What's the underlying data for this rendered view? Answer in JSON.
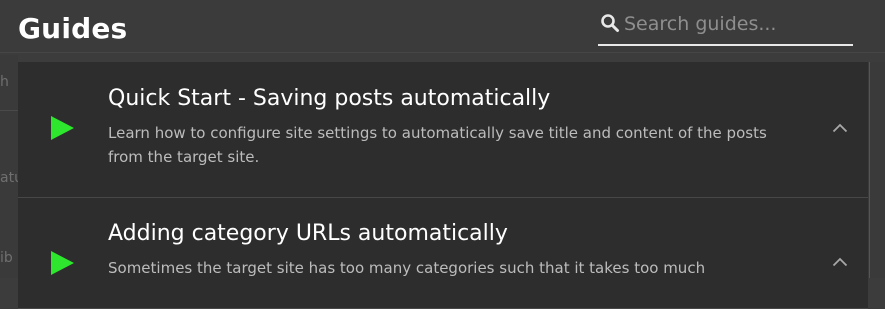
{
  "header": {
    "title": "Guides",
    "search": {
      "placeholder": "Search guides...",
      "value": ""
    }
  },
  "backdrop": {
    "fragments": [
      "h",
      "atu",
      "ib"
    ]
  },
  "guides": [
    {
      "title": "Quick Start - Saving posts automatically",
      "description": "Learn how to configure site settings to automatically save title and content of the posts from the target site.",
      "play_icon": "play-icon",
      "expand_icon": "chevron-up-icon"
    },
    {
      "title": "Adding category URLs automatically",
      "description": "Sometimes the target site has too many categories such that it takes too much",
      "play_icon": "play-icon",
      "expand_icon": "chevron-up-icon"
    }
  ],
  "colors": {
    "accent_play": "#2ee62e",
    "panel_bg": "#2d2d2d",
    "header_bg": "#3b3b3b"
  }
}
